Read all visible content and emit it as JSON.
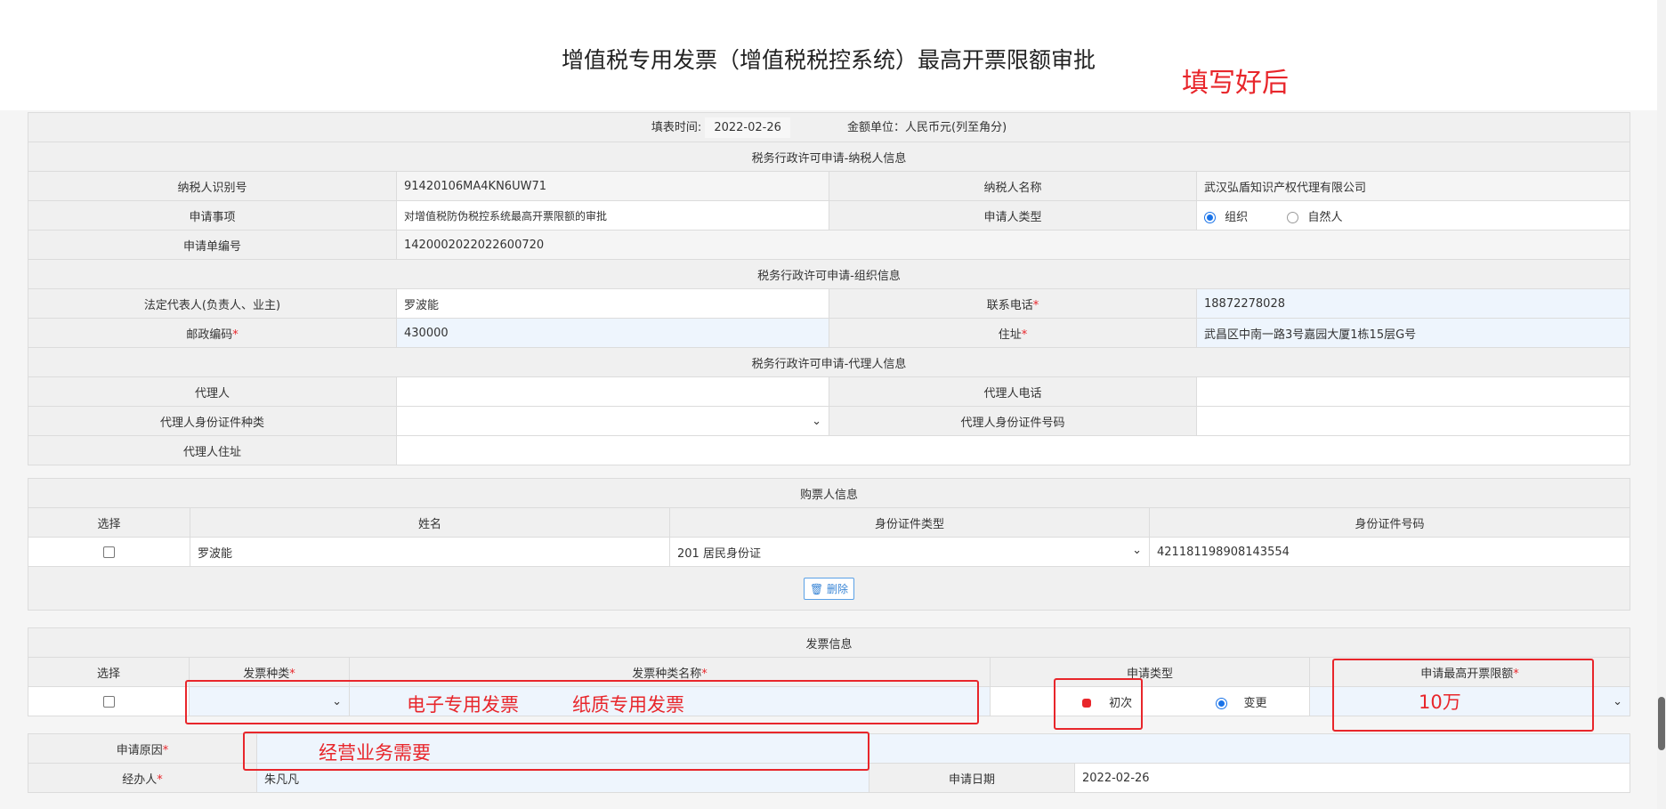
{
  "page_title": "增值税专用发票（增值税税控系统）最高开票限额审批",
  "annotations": {
    "after_filled": "填写好后",
    "invoice_names": [
      "电子专用发票",
      "纸质专用发票"
    ],
    "limit": "10万",
    "reason": "经营业务需要"
  },
  "form_meta": {
    "fill_time_label": "填表时间:",
    "fill_time_value": "2022-02-26",
    "unit_label": "金额单位：人民币元(列至角分)"
  },
  "taxpayer_section": {
    "header": "税务行政许可申请-纳税人信息",
    "id_label": "纳税人识别号",
    "id_value": "91420106MA4KN6UW71",
    "name_label": "纳税人名称",
    "name_value": "武汉弘盾知识产权代理有限公司",
    "matter_label": "申请事项",
    "matter_value": "对增值税防伪税控系统最高开票限额的审批",
    "applicant_type_label": "申请人类型",
    "applicant_type_options": [
      "组织",
      "自然人"
    ],
    "application_no_label": "申请单编号",
    "application_no_value": "1420002022022600720"
  },
  "org_section": {
    "header": "税务行政许可申请-组织信息",
    "legal_rep_label": "法定代表人(负责人、业主)",
    "legal_rep_value": "罗波能",
    "phone_label": "联系电话",
    "phone_value": "18872278028",
    "postcode_label": "邮政编码",
    "postcode_value": "430000",
    "address_label": "住址",
    "address_value": "武昌区中南一路3号嘉园大厦1栋15层G号"
  },
  "agent_section": {
    "header": "税务行政许可申请-代理人信息",
    "agent_label": "代理人",
    "agent_phone_label": "代理人电话",
    "agent_id_type_label": "代理人身份证件种类",
    "agent_id_no_label": "代理人身份证件号码",
    "agent_address_label": "代理人住址"
  },
  "buyer_section": {
    "header": "购票人信息",
    "col_select": "选择",
    "col_name": "姓名",
    "col_id_type": "身份证件类型",
    "col_id_no": "身份证件号码",
    "row_name": "罗波能",
    "row_id_type": "201 居民身份证",
    "row_id_no": "421181198908143554",
    "delete_label": "删除"
  },
  "invoice_section": {
    "header": "发票信息",
    "col_select": "选择",
    "col_type": "发票种类",
    "col_type_name": "发票种类名称",
    "col_apply_type": "申请类型",
    "col_limit": "申请最高开票限额",
    "apply_first": "初次",
    "apply_change": "变更"
  },
  "bottom": {
    "reason_label": "申请原因",
    "handler_label": "经办人",
    "handler_value": "朱凡凡",
    "date_label": "申请日期",
    "date_value": "2022-02-26"
  }
}
